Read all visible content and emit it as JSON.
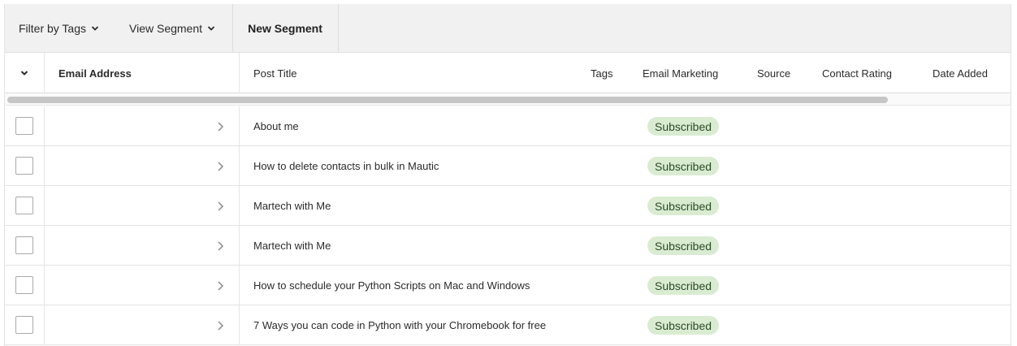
{
  "toolbar": {
    "filter_label": "Filter by Tags",
    "view_label": "View Segment",
    "new_segment_label": "New Segment"
  },
  "columns": {
    "email": "Email Address",
    "post_title": "Post Title",
    "tags": "Tags",
    "email_marketing": "Email Marketing",
    "source": "Source",
    "contact_rating": "Contact Rating",
    "date_added": "Date Added"
  },
  "rows": [
    {
      "post_title": "About me",
      "status": "Subscribed"
    },
    {
      "post_title": "How to delete contacts in bulk in Mautic",
      "status": "Subscribed"
    },
    {
      "post_title": "Martech with Me",
      "status": "Subscribed"
    },
    {
      "post_title": "Martech with Me",
      "status": "Subscribed"
    },
    {
      "post_title": "How to schedule your Python Scripts on Mac and Windows",
      "status": "Subscribed"
    },
    {
      "post_title": "7 Ways you can code in Python with your Chromebook for free",
      "status": "Subscribed"
    }
  ],
  "icons": {
    "dropdown": "chevron-down-icon",
    "row_expand": "chevron-right-icon"
  },
  "colors": {
    "toolbar_bg": "#f1f1f1",
    "badge_bg": "#d9ecd2",
    "badge_text": "#2c4b26"
  }
}
